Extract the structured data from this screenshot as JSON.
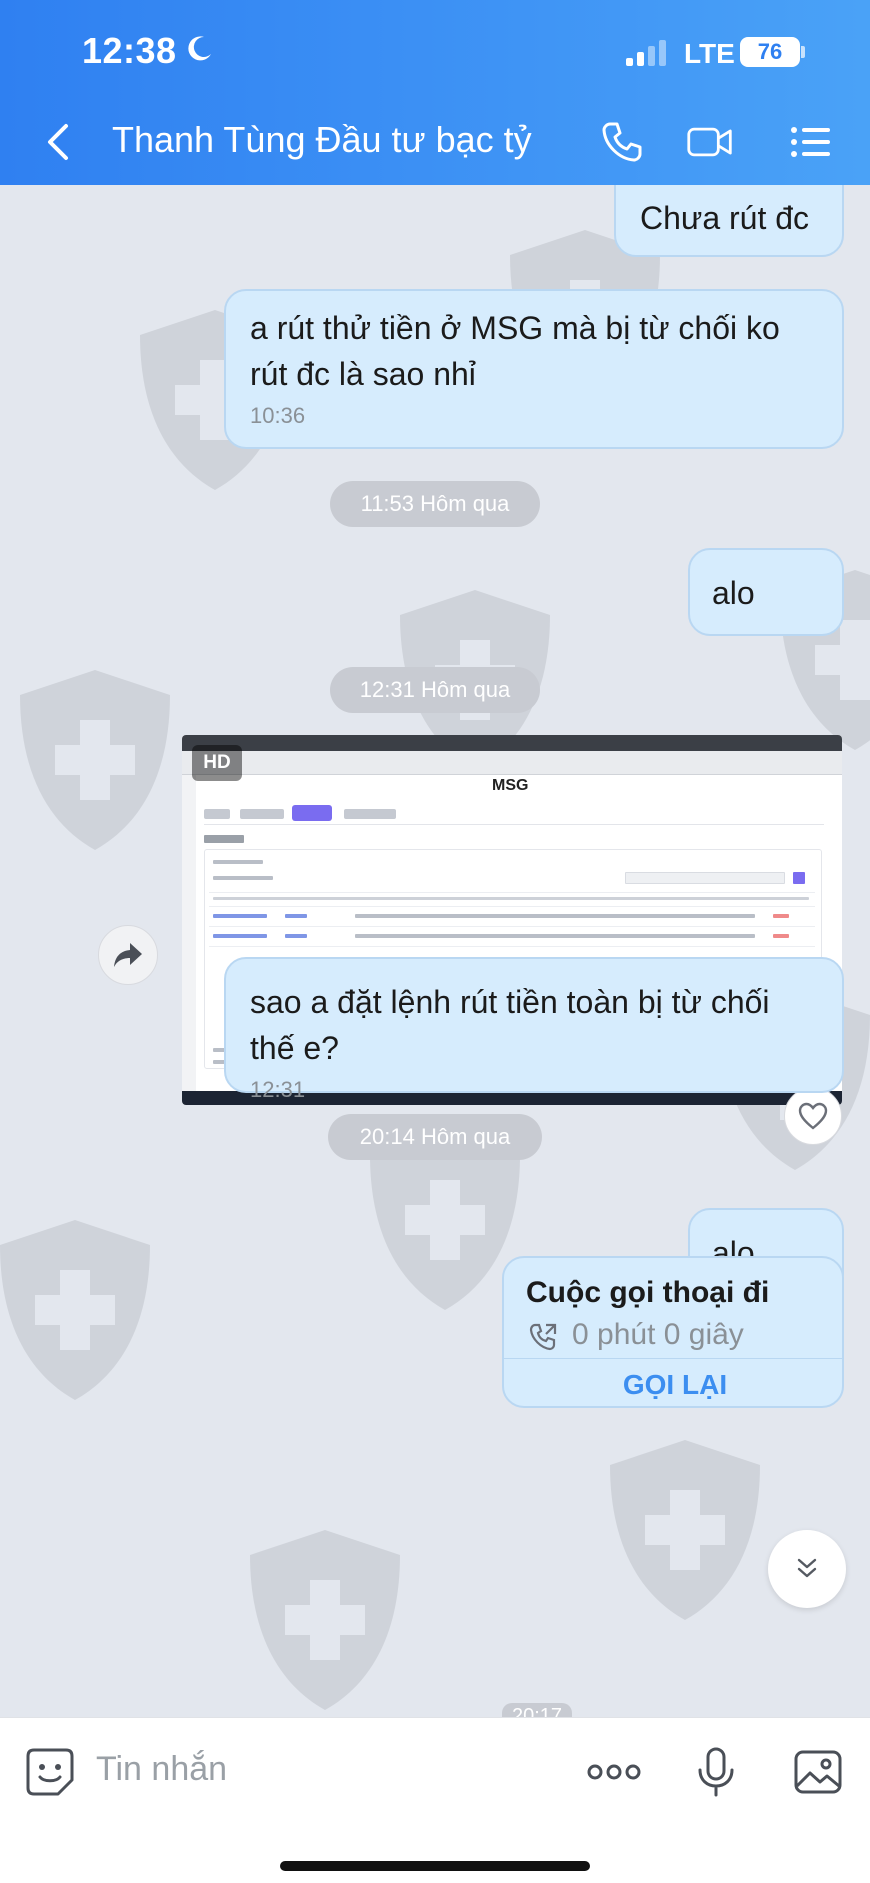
{
  "status_bar": {
    "time": "12:38",
    "network": "LTE",
    "battery": "76"
  },
  "header": {
    "title": "Thanh Tùng Đầu tư bạc tỷ"
  },
  "messages": {
    "m1": {
      "text": "Chưa rút đc"
    },
    "m2": {
      "text": "a rút thử tiền ở MSG mà bị từ chối ko rút đc là sao nhỉ",
      "time": "10:36"
    },
    "sep1": "11:53 Hôm qua",
    "m3": {
      "text": "alo"
    },
    "sep2": "12:31 Hôm qua",
    "image": {
      "badge": "HD",
      "logo": "MSG"
    },
    "m4": {
      "text": "sao a đặt lệnh rút tiền toàn bị từ chối thế e?",
      "time": "12:31"
    },
    "sep3": "20:14 Hôm qua",
    "m5": {
      "text": "alo"
    },
    "call": {
      "title": "Cuộc gọi thoại đi",
      "duration": "0 phút 0 giây",
      "callback": "GỌI LẠI"
    },
    "partial_time": "20:17"
  },
  "input": {
    "placeholder": "Tin nhắn"
  },
  "colors": {
    "header": "#3b8cf3",
    "bubble": "#d6ecfd",
    "bubble_border": "#b9d7f2",
    "accent": "#3c8ef0",
    "background": "#e3e7ee"
  }
}
